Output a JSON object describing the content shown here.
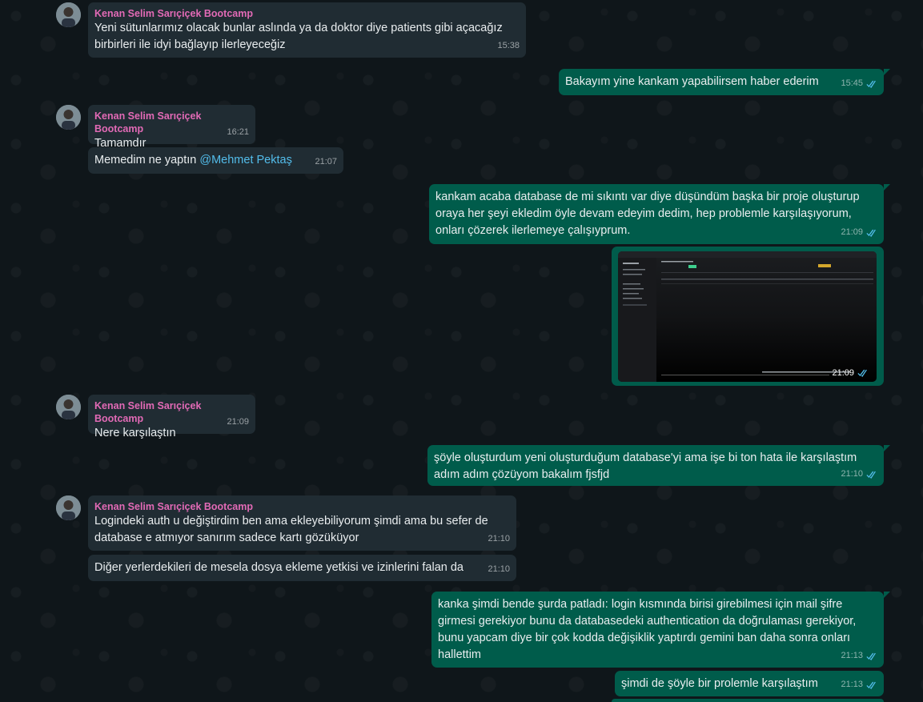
{
  "messages": [
    {
      "sender": "Kenan Selim Sarıçiçek Bootcamp",
      "text": "Yeni sütunlarımız olacak bunlar aslında ya da doktor diye patients gibi açacağız birbirleri ile idyi bağlayıp ilerleyeceğiz",
      "time": "15:38"
    },
    {
      "text": "Bakayım yine kankam yapabilirsem haber ederim",
      "time": "15:45"
    },
    {
      "sender": "Kenan Selim Sarıçiçek Bootcamp",
      "text": "Tamamdır",
      "time": "16:21"
    },
    {
      "text_prefix": "Memedim ne yaptın ",
      "mention": "@Mehmet Pektaş",
      "time": "21:07"
    },
    {
      "text": "kankam acaba database de mi sıkıntı var diye düşündüm başka bir proje oluşturup oraya her şeyi ekledim öyle devam edeyim dedim, hep problemle karşılaşıyorum, onları çözerek ilerlemeye çalışıyprum.",
      "time": "21:09"
    },
    {
      "time": "21:09"
    },
    {
      "sender": "Kenan Selim Sarıçiçek Bootcamp",
      "text": "Nere karşılaştın",
      "time": "21:09"
    },
    {
      "text": "şöyle oluşturdum yeni oluşturduğum database'yi ama işe bi ton hata ile karşılaştım adım adım çözüyom bakalım fjsfjd",
      "time": "21:10"
    },
    {
      "sender": "Kenan Selim Sarıçiçek Bootcamp",
      "text": "Logindeki auth u değiştirdim ben ama ekleyebiliyorum şimdi ama bu sefer de database e atmıyor sanırım sadece kartı gözüküyor",
      "time": "21:10"
    },
    {
      "text": "Diğer yerlerdekileri de mesela dosya ekleme yetkisi ve izinlerini falan da",
      "time": "21:10"
    },
    {
      "text": "kanka şimdi bende şurda patladı: login kısmında birisi girebilmesi için mail şifre girmesi gerekiyor bunu da databasedeki authentication da doğrulaması gerekiyor, bunu yapcam diye bir çok kodda değişiklik yaptırdı gemini ban daha sonra onları hallettim",
      "time": "21:13"
    },
    {
      "text": "şimdi de şöyle bir prolemle karşılaştım",
      "time": "21:13"
    }
  ],
  "colors": {
    "incoming": "#202c33",
    "outgoing": "#005c4b",
    "sender": "#e26ab6",
    "mention": "#53bdeb",
    "tick": "#53bdeb"
  },
  "icons": {
    "read_receipt": "double-check-icon",
    "avatar": "user-avatar"
  }
}
